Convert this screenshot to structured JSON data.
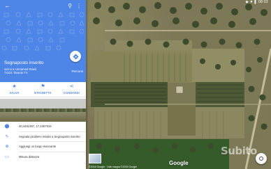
{
  "status_bar": {
    "right_text": "◆ ▼ ▌ 08:02"
  },
  "panel": {
    "title": "Segnaposto inserito",
    "address_line1": "vicino a Unnamed Road",
    "address_line2": "74121 Taranto TA",
    "route_label": "Percorsi",
    "actions": [
      {
        "label": "SALVA",
        "icon": "star-icon"
      },
      {
        "label": "ETICHETTA",
        "icon": "flag-icon"
      },
      {
        "label": "CONDIVIDI",
        "icon": "share-icon"
      }
    ],
    "details": [
      {
        "text": "40,4491367, 17,4307618",
        "icon": "location-pin-icon"
      },
      {
        "text": "Segnala problemi relativi a Segnaposto inserito",
        "icon": "edit-icon"
      },
      {
        "text": "Aggiungi un luogo mancante",
        "icon": "add-place-icon"
      },
      {
        "text": "Misura distanza",
        "icon": "ruler-icon"
      }
    ]
  },
  "map": {
    "google_logo": "Google",
    "copyright": "©2016 Google · Dati mappa ©2016 Google",
    "watermark": "Subito"
  },
  "colors": {
    "accent": "#4e86e8",
    "panel_bg": "#ffffff"
  }
}
